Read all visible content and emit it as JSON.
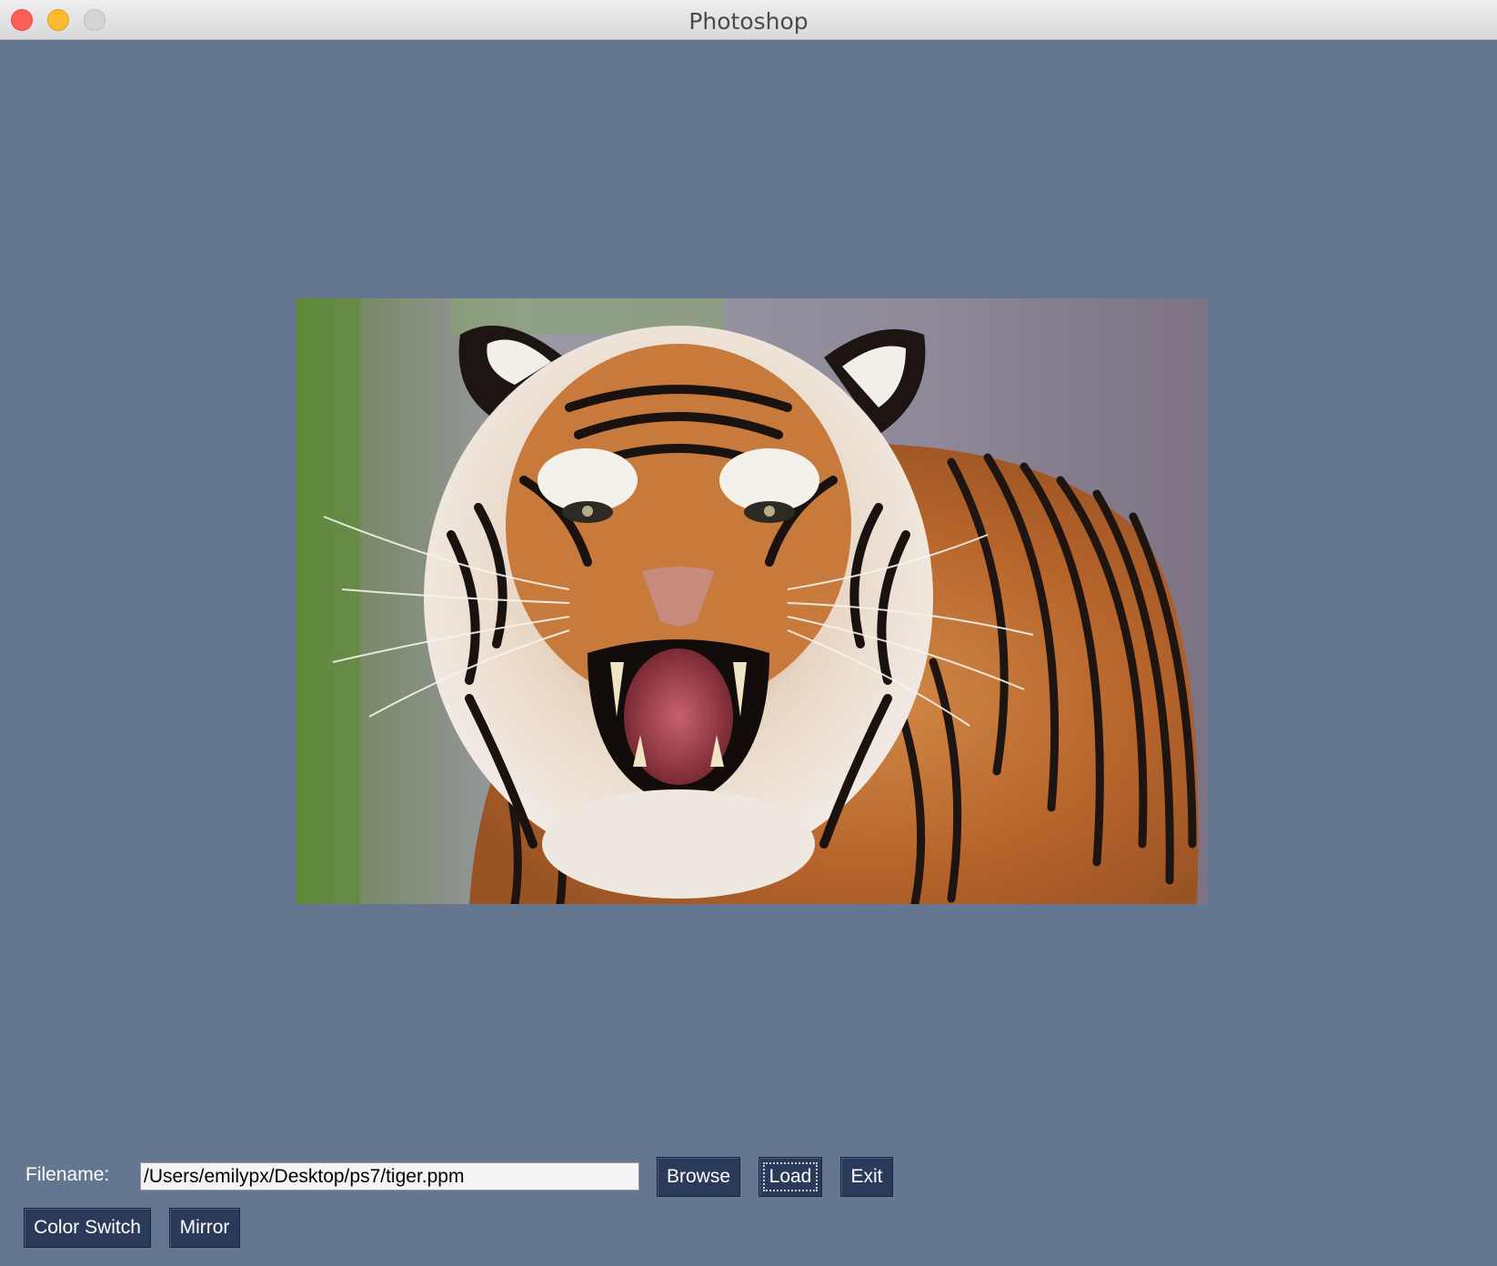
{
  "window": {
    "title": "Photoshop"
  },
  "image": {
    "description_alt": "tiger.ppm"
  },
  "controls": {
    "filename_label": "Filename:",
    "filename_value": "/Users/emilypx/Desktop/ps7/tiger.ppm",
    "browse_label": "Browse",
    "load_label": "Load",
    "exit_label": "Exit",
    "color_switch_label": "Color Switch",
    "mirror_label": "Mirror"
  },
  "colors": {
    "background": "#647690",
    "button": "#2b3a5a"
  }
}
